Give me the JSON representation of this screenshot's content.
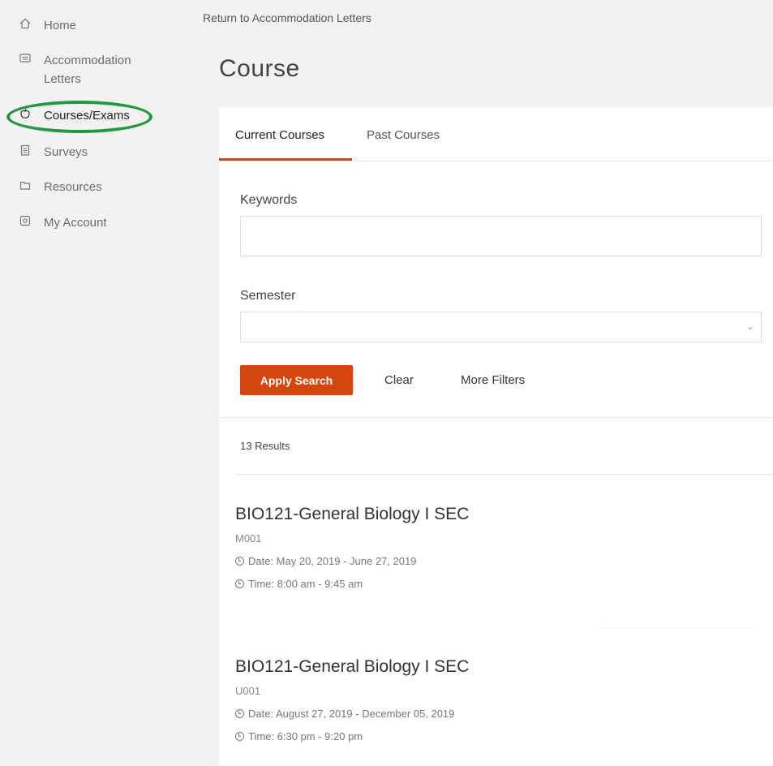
{
  "sidebar": {
    "items": [
      {
        "label": "Home",
        "icon": "home-icon"
      },
      {
        "label": "Accommodation\nLetters",
        "icon": "letters-icon"
      },
      {
        "label": "Courses/Exams",
        "icon": "apple-icon"
      },
      {
        "label": "Surveys",
        "icon": "survey-icon"
      },
      {
        "label": "Resources",
        "icon": "resources-icon"
      },
      {
        "label": "My Account",
        "icon": "account-icon"
      }
    ],
    "highlight_color": "#1f9a3f"
  },
  "header": {
    "back_link": "Return to Accommodation Letters",
    "title": "Course"
  },
  "tabs": [
    {
      "label": "Current Courses",
      "active": true
    },
    {
      "label": "Past Courses",
      "active": false
    }
  ],
  "search": {
    "keywords_label": "Keywords",
    "keywords_value": "",
    "semester_label": "Semester",
    "semester_value": "",
    "apply_label": "Apply Search",
    "clear_label": "Clear",
    "more_filters_label": "More Filters"
  },
  "results": {
    "count_text": "13 Results",
    "courses": [
      {
        "title": "BIO121-General Biology I SEC",
        "section": "M001",
        "date": "Date: May 20, 2019 - June 27, 2019",
        "time": "Time: 8:00 am - 9:45 am"
      },
      {
        "title": "BIO121-General Biology I SEC",
        "section": "U001",
        "date": "Date: August 27, 2019 - December 05, 2019",
        "time": "Time: 6:30 pm - 9:20 pm"
      }
    ]
  },
  "colors": {
    "accent": "#d4460e",
    "background": "#f2f2f2",
    "card": "#ffffff"
  }
}
